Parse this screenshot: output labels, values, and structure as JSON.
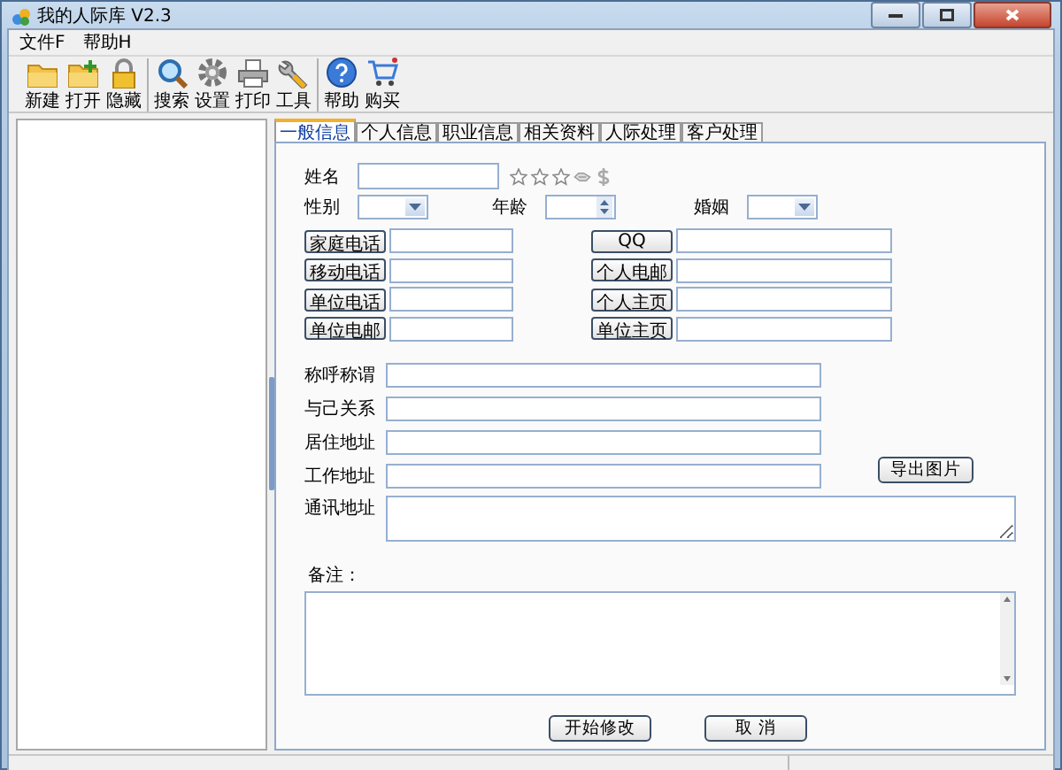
{
  "window": {
    "title": "我的人际库 V2.3"
  },
  "menu": [
    "文件F",
    "帮助H"
  ],
  "toolbar": [
    [
      {
        "label": "新建",
        "kind": "folder"
      },
      {
        "label": "打开",
        "kind": "folder-add"
      },
      {
        "label": "隐藏",
        "kind": "lock"
      }
    ],
    [
      {
        "label": "搜索",
        "kind": "search"
      },
      {
        "label": "设置",
        "kind": "gear"
      },
      {
        "label": "打印",
        "kind": "printer"
      },
      {
        "label": "工具",
        "kind": "wrench"
      }
    ],
    [
      {
        "label": "帮助",
        "kind": "help"
      },
      {
        "label": "购买",
        "kind": "cart"
      }
    ]
  ],
  "tabs": [
    {
      "label": "一般信息",
      "selected": true
    },
    {
      "label": "个人信息",
      "selected": false
    },
    {
      "label": "职业信息",
      "selected": false
    },
    {
      "label": "相关资料",
      "selected": false
    },
    {
      "label": "人际处理",
      "selected": false
    },
    {
      "label": "客户处理",
      "selected": false
    }
  ],
  "form": {
    "name_label": "姓名",
    "stars": 0,
    "gender_label": "性别",
    "age_label": "年龄",
    "marriage_label": "婚姻",
    "contacts": [
      [
        "家庭电话",
        "QQ"
      ],
      [
        "移动电话",
        "个人电邮"
      ],
      [
        "单位电话",
        "个人主页"
      ],
      [
        "单位电邮",
        "单位主页"
      ]
    ],
    "address_rows": [
      "称呼称谓",
      "与己关系",
      "居住地址",
      "工作地址"
    ],
    "mail_label": "通讯地址",
    "export_button": "导出图片",
    "notes_label": "备注：",
    "actions": [
      "开始修改",
      "取 消"
    ]
  }
}
